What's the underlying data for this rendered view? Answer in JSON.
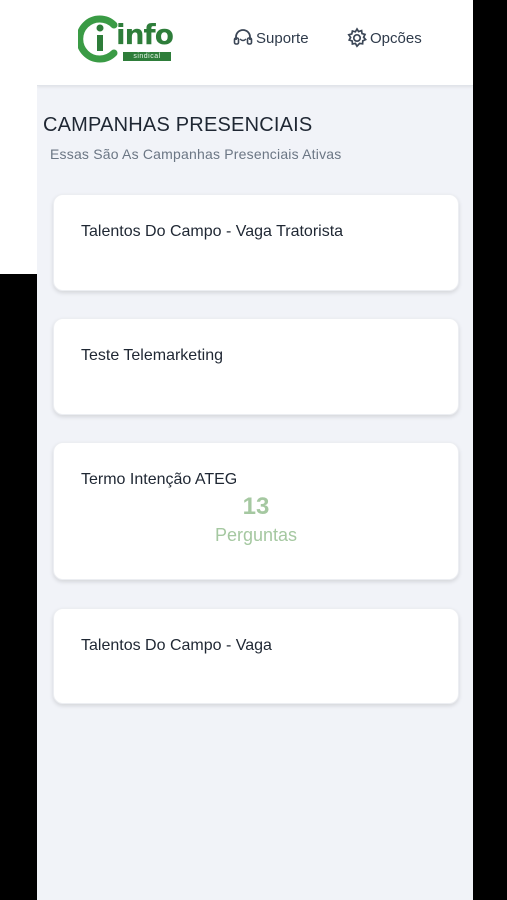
{
  "header": {
    "logo_main": "info",
    "logo_sub": "sindical",
    "support_label": "Suporte",
    "options_label": "Opcões"
  },
  "page": {
    "title": "CAMPANHAS PRESENCIAIS",
    "subtitle": "Essas São As Campanhas Presenciais Ativas"
  },
  "campaigns": [
    {
      "title": "Talentos Do Campo - Vaga Tratorista"
    },
    {
      "title": "Teste Telemarketing"
    },
    {
      "title": "Termo Intenção ATEG",
      "count": "13",
      "count_label": "Perguntas"
    },
    {
      "title": "Talentos Do Campo - Vaga"
    }
  ],
  "colors": {
    "brand_green": "#2e7d3a",
    "count_green": "#a5c8a1",
    "background": "#f1f3f8"
  }
}
